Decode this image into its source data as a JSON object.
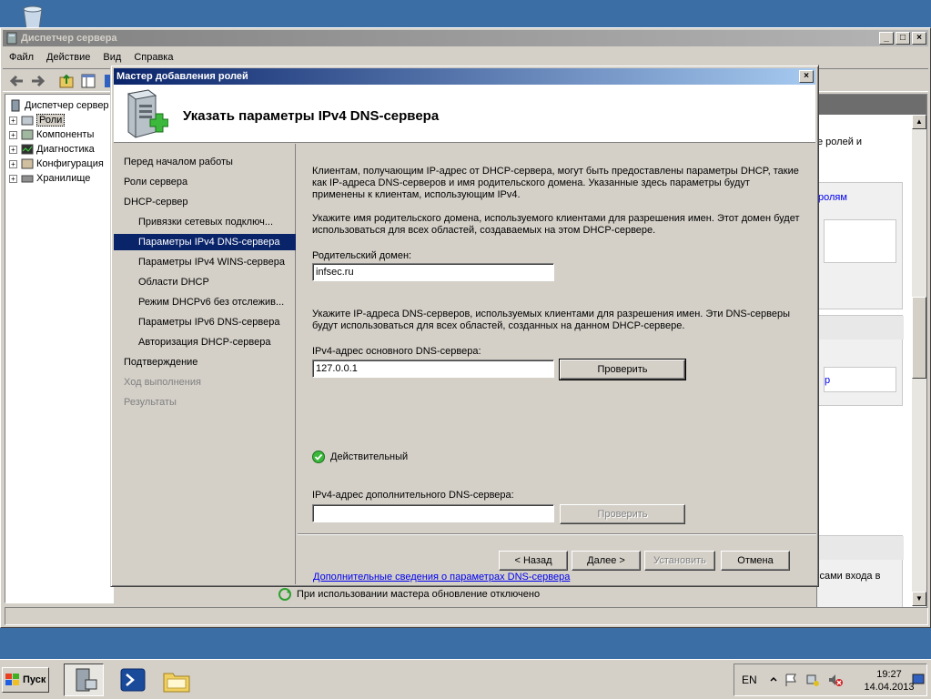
{
  "main_window": {
    "title": "Диспетчер сервера",
    "menu": [
      "Файл",
      "Действие",
      "Вид",
      "Справка"
    ],
    "tree": [
      {
        "label": "Диспетчер сервер",
        "expander": false
      },
      {
        "label": "Роли",
        "expander": true
      },
      {
        "label": "Компоненты",
        "expander": true
      },
      {
        "label": "Диагностика",
        "expander": true
      },
      {
        "label": "Конфигурация",
        "expander": true
      },
      {
        "label": "Хранилище",
        "expander": true
      }
    ],
    "right_pane": {
      "text1": "е ролей и",
      "link1": "ролям",
      "link2": "р",
      "text2": "ссами входа в"
    },
    "status": "При использовании мастера обновление отключено"
  },
  "dialog": {
    "title": "Мастер добавления ролей",
    "heading": "Указать параметры IPv4 DNS-сервера",
    "nav": [
      {
        "label": "Перед началом работы",
        "level": 1,
        "state": "normal"
      },
      {
        "label": "Роли сервера",
        "level": 1,
        "state": "normal"
      },
      {
        "label": "DHCP-сервер",
        "level": 1,
        "state": "normal"
      },
      {
        "label": "Привязки сетевых подключ...",
        "level": 2,
        "state": "normal"
      },
      {
        "label": "Параметры IPv4 DNS-сервера",
        "level": 2,
        "state": "selected"
      },
      {
        "label": "Параметры IPv4 WINS-сервера",
        "level": 2,
        "state": "normal"
      },
      {
        "label": "Области DHCP",
        "level": 2,
        "state": "normal"
      },
      {
        "label": "Режим DHCPv6 без отслежив...",
        "level": 2,
        "state": "normal"
      },
      {
        "label": "Параметры IPv6 DNS-сервера",
        "level": 2,
        "state": "normal"
      },
      {
        "label": "Авторизация DHCP-сервера",
        "level": 2,
        "state": "normal"
      },
      {
        "label": "Подтверждение",
        "level": 1,
        "state": "normal"
      },
      {
        "label": "Ход выполнения",
        "level": 1,
        "state": "disabled"
      },
      {
        "label": "Результаты",
        "level": 1,
        "state": "disabled"
      }
    ],
    "intro": "Клиентам, получающим IP-адрес от DHCP-сервера, могут быть предоставлены параметры DHCP, такие как IP-адреса DNS-серверов и имя родительского домена. Указанные здесь параметры будут применены к клиентам, использующим IPv4.",
    "domain_info": "Укажите имя родительского домена, используемого клиентами для разрешения имен. Этот домен будет использоваться для всех областей, создаваемых на этом DHCP-сервере.",
    "domain_label": "Родительский домен:",
    "domain_value": "infsec.ru",
    "dns_info": "Укажите IP-адреса DNS-серверов, используемых клиентами для разрешения имен. Эти DNS-серверы будут использоваться для всех областей, созданных на данном DHCP-сервере.",
    "primary_label": "IPv4-адрес основного DNS-сервера:",
    "primary_value": "127.0.0.1",
    "verify_label": "Проверить",
    "valid_text": "Действительный",
    "secondary_label": "IPv4-адрес дополнительного DNS-сервера:",
    "secondary_value": "",
    "verify2_label": "Проверить",
    "more_link": "Дополнительные сведения о параметрах DNS-сервера",
    "buttons": {
      "back": "< Назад",
      "next": "Далее >",
      "install": "Установить",
      "cancel": "Отмена"
    }
  },
  "taskbar": {
    "start": "Пуск",
    "lang": "EN",
    "time": "19:27",
    "date": "14.04.2013"
  },
  "colors": {
    "desktop": "#3a6ea5",
    "title_active": "#0a246a",
    "selection": "#0a246a",
    "link": "#0000ee"
  }
}
